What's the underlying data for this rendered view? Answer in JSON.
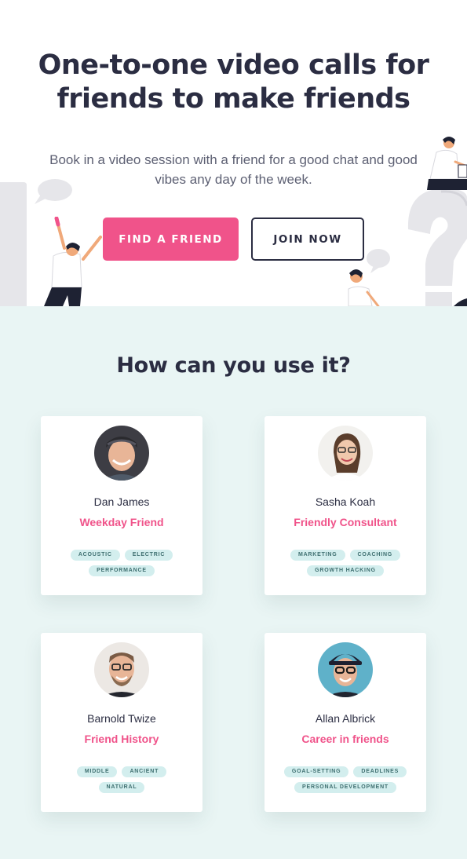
{
  "hero": {
    "title_line1": "One-to-one video calls for",
    "title_line2": "friends to make friends",
    "subtitle_line1": "Book in a video session with a friend for a good chat and good",
    "subtitle_line2": "vibes any day of the week.",
    "find_button": "FIND A FRIEND",
    "join_button": "JOIN NOW"
  },
  "section": {
    "title": "How can you use it?"
  },
  "cards": [
    {
      "name": "Dan James",
      "role": "Weekday Friend",
      "tags": [
        "ACOUSTIC",
        "ELECTRIC",
        "PERFORMANCE"
      ]
    },
    {
      "name": "Sasha Koah",
      "role": "Friendly Consultant",
      "tags": [
        "MARKETING",
        "COACHING",
        "GROWTH HACKING"
      ]
    },
    {
      "name": "Barnold Twize",
      "role": "Friend History",
      "tags": [
        "MIDDLE",
        "ANCIENT",
        "NATURAL"
      ]
    },
    {
      "name": "Allan Albrick",
      "role": "Career in friends",
      "tags": [
        "GOAL-SETTING",
        "DEADLINES",
        "PERSONAL DEVELOPMENT"
      ]
    }
  ],
  "colors": {
    "accent": "#f0538a",
    "heading": "#2b2d42",
    "section_bg": "#e9f5f4",
    "tag_bg": "#d3eeee"
  },
  "icons": [
    "speech-bubble-icon",
    "question-mark-illustration",
    "person-illustration"
  ]
}
